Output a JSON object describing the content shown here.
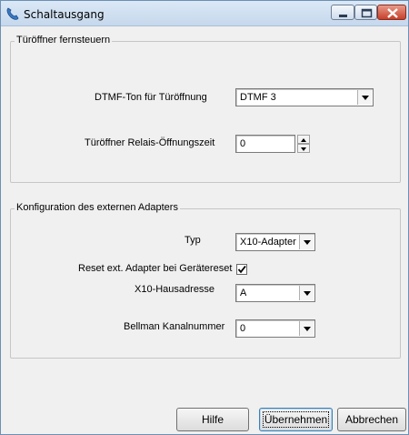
{
  "window": {
    "title": "Schaltausgang"
  },
  "door_group": {
    "legend": "Türöffner fernsteuern",
    "dtmf_label": "DTMF-Ton für Türöffnung",
    "dtmf_value": "DTMF 3",
    "relay_label": "Türöffner Relais-Öffnungszeit",
    "relay_value": "0"
  },
  "adapter_group": {
    "legend": "Konfiguration des externen Adapters",
    "type_label": "Typ",
    "type_value": "X10-Adapter (",
    "reset_label": "Reset ext. Adapter bei Gerätereset",
    "reset_checked": true,
    "house_label": "X10-Hausadresse",
    "house_value": "A",
    "channel_label": "Bellman Kanalnummer",
    "channel_value": "0"
  },
  "buttons": {
    "help": "Hilfe",
    "apply": "Übernehmen",
    "cancel": "Abbrechen"
  }
}
